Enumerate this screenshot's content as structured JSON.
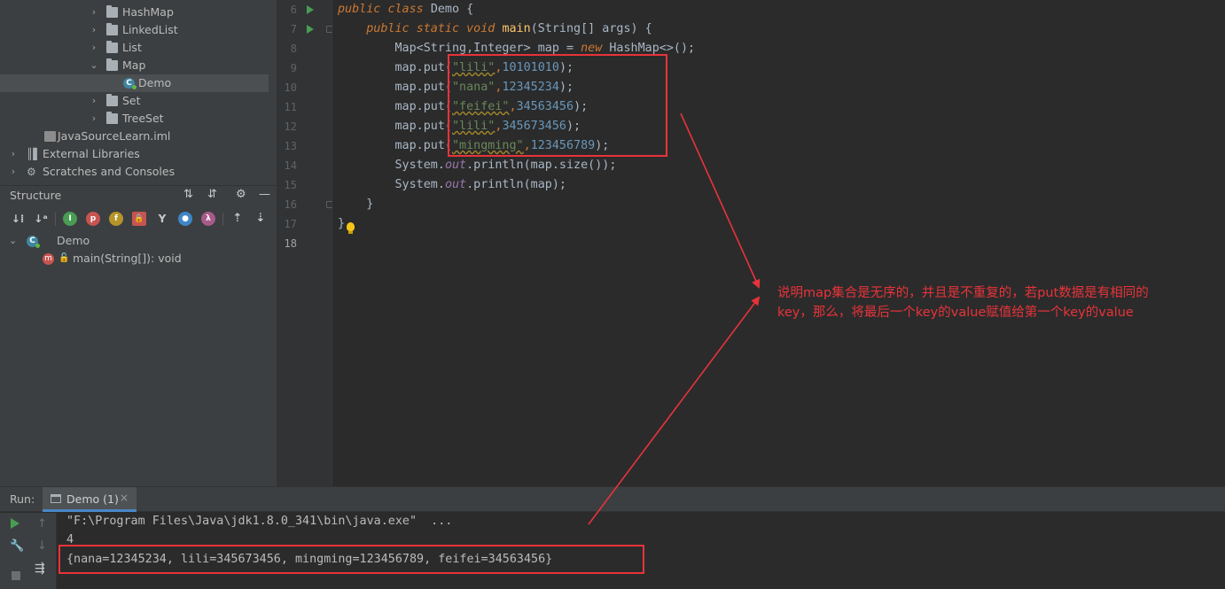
{
  "project_tree": {
    "items": [
      {
        "label": "HashMap",
        "type": "folder",
        "expanded": false
      },
      {
        "label": "LinkedList",
        "type": "folder",
        "expanded": false
      },
      {
        "label": "List",
        "type": "folder",
        "expanded": false
      },
      {
        "label": "Map",
        "type": "folder",
        "expanded": true
      },
      {
        "label": "Demo",
        "type": "class",
        "selected": true
      },
      {
        "label": "Set",
        "type": "folder",
        "expanded": false
      },
      {
        "label": "TreeSet",
        "type": "folder",
        "expanded": false
      },
      {
        "label": "JavaSourceLearn.iml",
        "type": "iml"
      },
      {
        "label": "External Libraries",
        "type": "libraries"
      },
      {
        "label": "Scratches and Consoles",
        "type": "scratches"
      }
    ]
  },
  "structure": {
    "title": "Structure",
    "tree": [
      {
        "label": "Demo",
        "type": "class"
      },
      {
        "label": "main(String[]): void",
        "type": "method"
      }
    ]
  },
  "editor": {
    "line_numbers": [
      "6",
      "7",
      "8",
      "9",
      "10",
      "11",
      "12",
      "13",
      "14",
      "15",
      "16",
      "17",
      "18"
    ],
    "current_line": "18",
    "code": {
      "l6": {
        "kw1": "public",
        "kw2": "class",
        "name": "Demo",
        "rest": " {"
      },
      "l7": {
        "kw1": "public",
        "kw2": "static",
        "kw3": "void",
        "name": "main",
        "rest": "(String[] args) {"
      },
      "l8": {
        "pre": "Map<String,Integer> map = ",
        "kw": "new",
        "post": " HashMap<>();"
      },
      "l9": {
        "pre": "map.put(",
        "str": "\"lili\"",
        "comma": ",",
        "num": "10101010",
        "post": ");"
      },
      "l10": {
        "pre": "map.put(",
        "str": "\"nana\"",
        "comma": ",",
        "num": "12345234",
        "post": ");"
      },
      "l11": {
        "pre": "map.put(",
        "str": "\"feifei\"",
        "comma": ",",
        "num": "34563456",
        "post": ");"
      },
      "l12": {
        "pre": "map.put(",
        "str": "\"lili\"",
        "comma": ",",
        "num": "345673456",
        "post": ");"
      },
      "l13": {
        "pre": "map.put(",
        "str": "\"mingming\"",
        "comma": ",",
        "num": "123456789",
        "post": ");"
      },
      "l14": {
        "pre": "System.",
        "fld": "out",
        "post": ".println(map.size());"
      },
      "l15": {
        "pre": "System.",
        "fld": "out",
        "post": ".println(map);"
      },
      "l16": {
        "text": "}"
      },
      "l17": {
        "text": "}"
      }
    }
  },
  "run": {
    "label": "Run:",
    "tab_label": "Demo (1)",
    "tab_close": "×",
    "output": [
      "\"F:\\Program Files\\Java\\jdk1.8.0_341\\bin\\java.exe\"  ...",
      "4",
      "{nana=12345234, lili=345673456, mingming=123456789, feifei=34563456}"
    ]
  },
  "annotation": {
    "line1": "说明map集合是无序的，并且是不重复的，若put数据是有相同的",
    "line2": "key，那么，将最后一个key的value赋值给第一个key的value",
    "color": "#e8333a"
  }
}
